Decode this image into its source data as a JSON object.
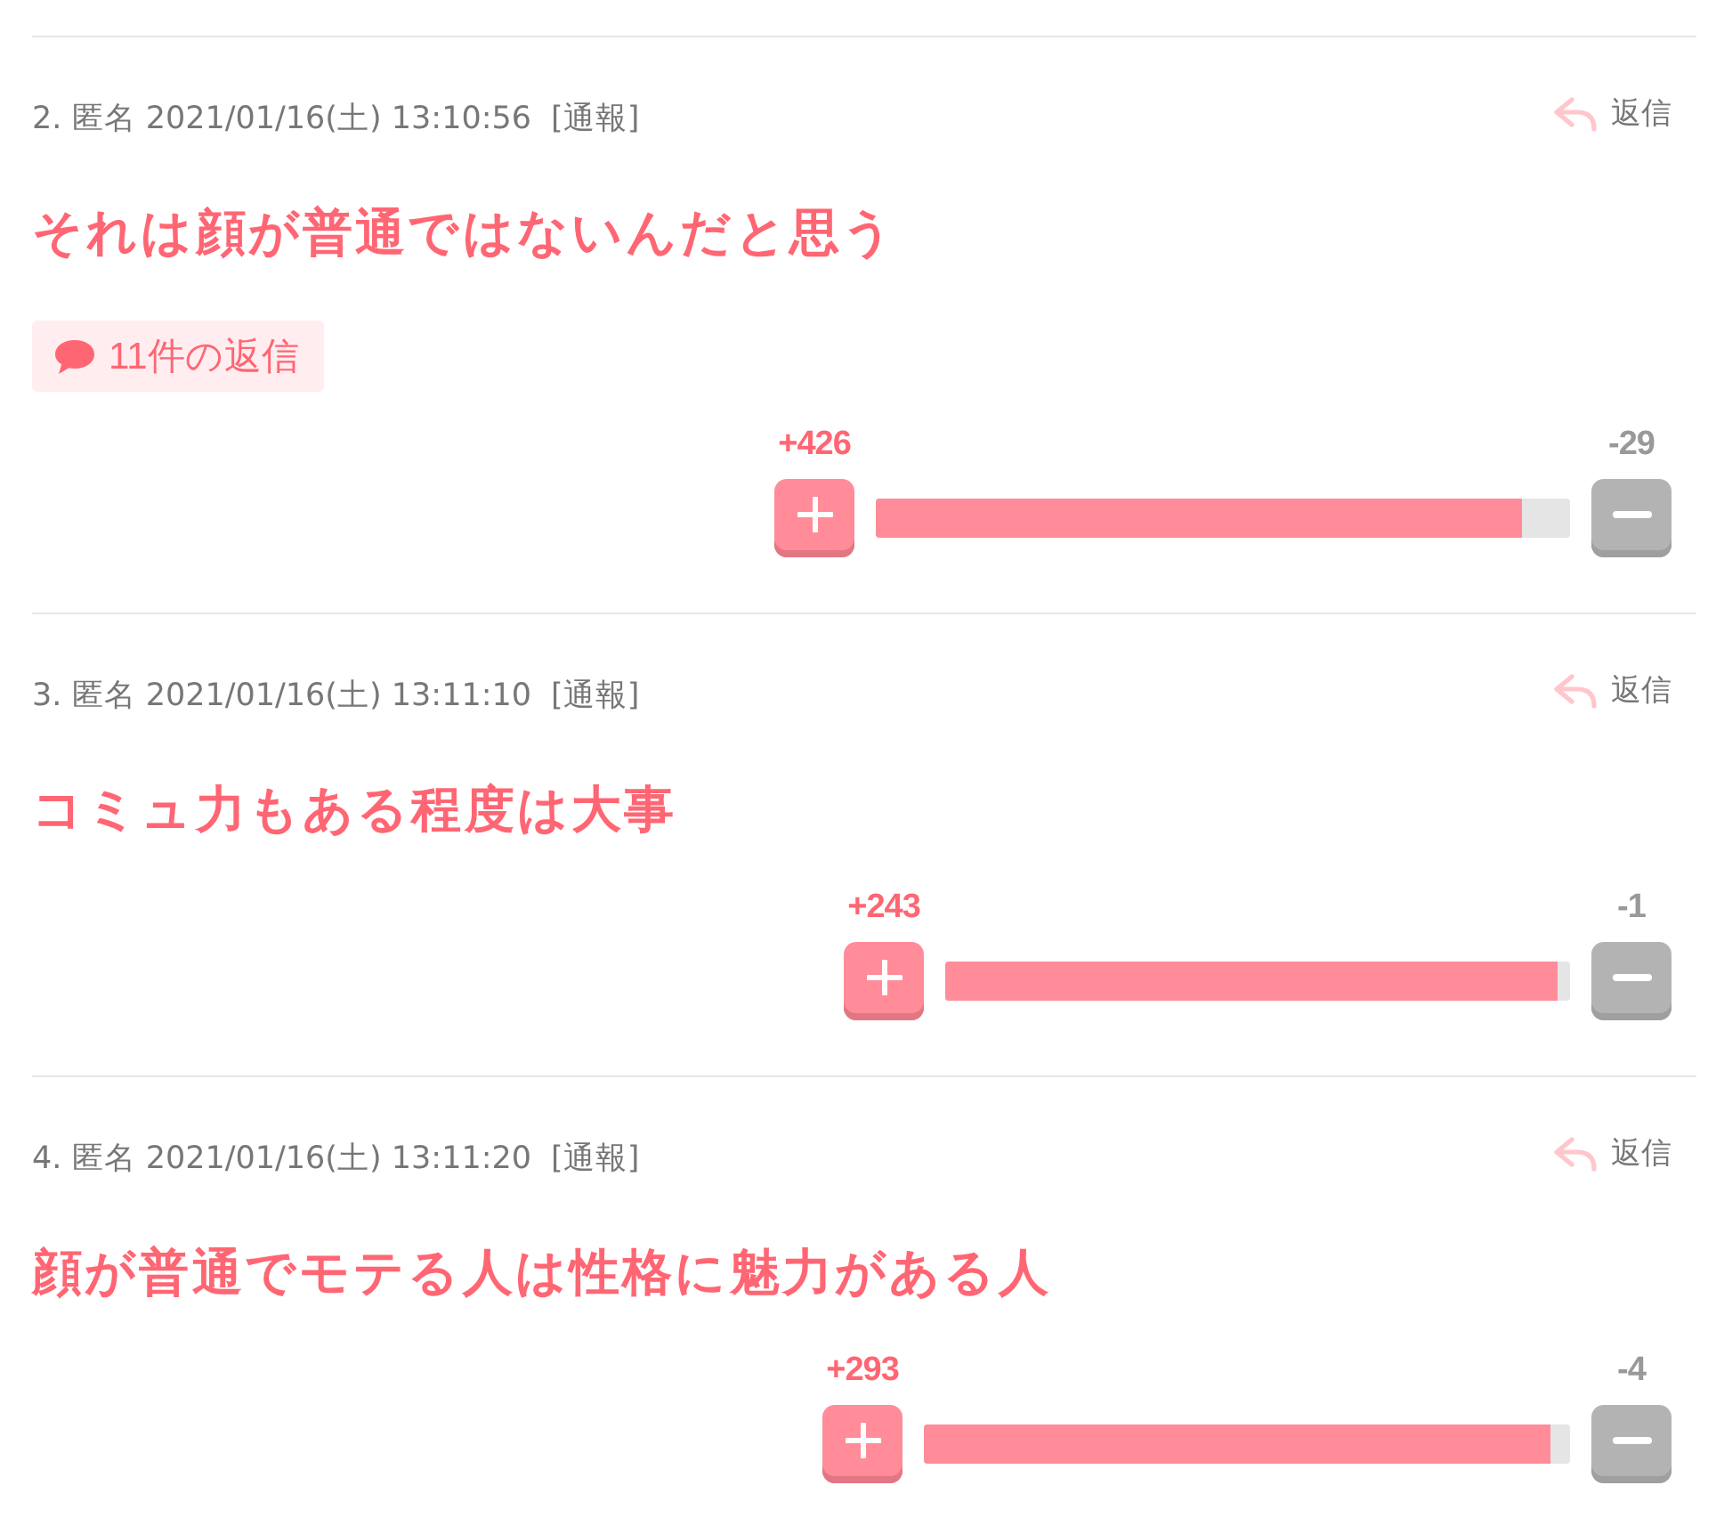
{
  "comments": [
    {
      "header": "2. 匿名 2021/01/16(土) 13:10:56",
      "report": "[通報]",
      "reply_action": "返信",
      "body": "それは顔が普通ではないんだと思う",
      "replies": "11件の返信",
      "votes": {
        "plus": "+426",
        "minus": "-29",
        "level": 0.93
      }
    },
    {
      "header": "3. 匿名 2021/01/16(土) 13:11:10",
      "report": "[通報]",
      "reply_action": "返信",
      "body": "コミュ力もある程度は大事",
      "votes": {
        "plus": "+243",
        "minus": "-1",
        "level": 0.98
      }
    },
    {
      "header": "4. 匿名 2021/01/16(土) 13:11:20",
      "report": "[通報]",
      "reply_action": "返信",
      "body": "顔が普通でモテる人は性格に魅力がある人",
      "votes": {
        "plus": "+293",
        "minus": "-4",
        "level": 0.97
      }
    }
  ]
}
